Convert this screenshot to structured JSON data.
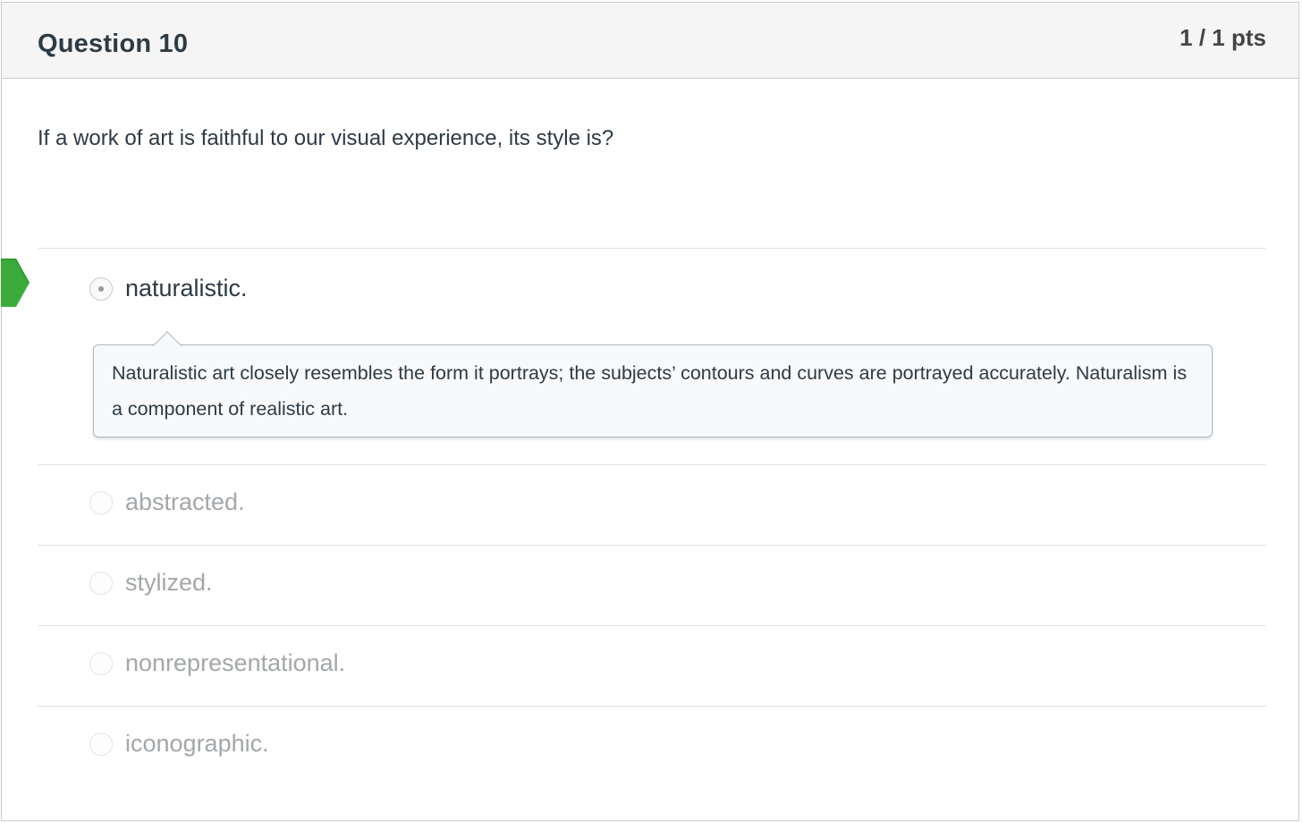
{
  "question": {
    "title": "Question 10",
    "points": "1 / 1 pts",
    "text": "If a work of art is faithful to our visual experience, its style is?"
  },
  "answers": [
    {
      "label": "naturalistic.",
      "selected": true,
      "correct": true,
      "comment": "Naturalistic art closely resembles the form it portrays; the subjects’ contours and curves are portrayed accurately. Naturalism is a component of realistic art."
    },
    {
      "label": "abstracted.",
      "selected": false
    },
    {
      "label": "stylized.",
      "selected": false
    },
    {
      "label": "nonrepresentational.",
      "selected": false
    },
    {
      "label": "iconographic.",
      "selected": false
    }
  ],
  "colors": {
    "correct_marker": "#3aab3a",
    "header_bg": "#f5f5f5",
    "text_dark": "#2d3b45",
    "text_muted": "#a3a7aa"
  },
  "icons": {
    "correct_marker": "correct-answer-arrow-icon",
    "radio_checked": "radio-checked-icon",
    "radio_unchecked": "radio-unchecked-icon"
  }
}
